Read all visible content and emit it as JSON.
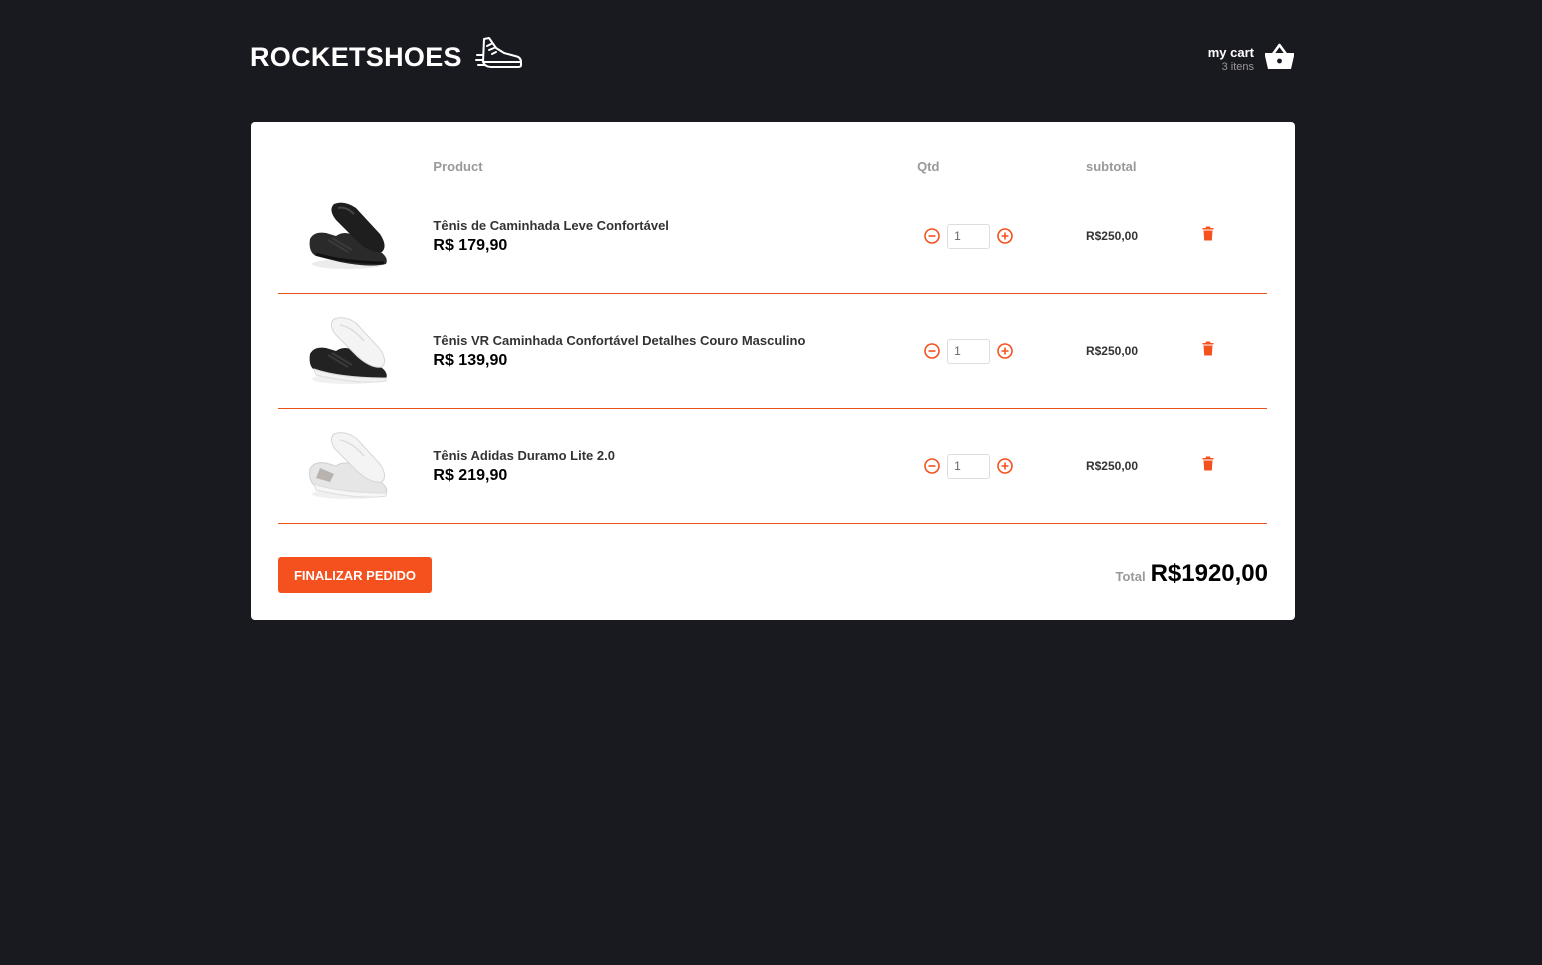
{
  "header": {
    "logo_text": "ROCKETSHOES",
    "cart_title": "my cart",
    "cart_count": "3 itens"
  },
  "table": {
    "headers": [
      "",
      "Product",
      "Qtd",
      "subtotal",
      ""
    ]
  },
  "items": [
    {
      "title": "Tênis de Caminhada Leve Confortável",
      "price": "R$ 179,90",
      "qty": "1",
      "subtotal": "R$250,00",
      "image": "black-sneaker"
    },
    {
      "title": "Tênis VR Caminhada Confortável Detalhes Couro Masculino",
      "price": "R$ 139,90",
      "qty": "1",
      "subtotal": "R$250,00",
      "image": "black-white-sneaker"
    },
    {
      "title": "Tênis Adidas Duramo Lite 2.0",
      "price": "R$ 219,90",
      "qty": "1",
      "subtotal": "R$250,00",
      "image": "white-sneaker"
    }
  ],
  "footer": {
    "checkout_label": "FINALIZAR PEDIDO",
    "total_label": "Total",
    "total_value": "R$1920,00"
  },
  "colors": {
    "background": "#191920",
    "accent": "#f4511e",
    "panel": "#ffffff"
  }
}
